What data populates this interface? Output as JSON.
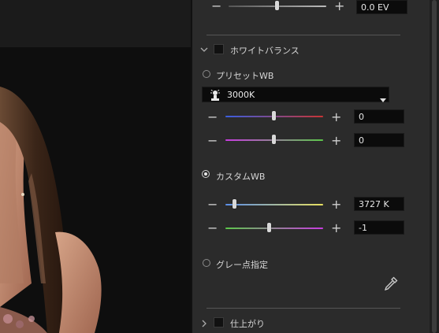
{
  "exposure": {
    "value": "0.0 EV",
    "slider_level": 0.5
  },
  "white_balance": {
    "title": "ホワイトバランス",
    "preset": {
      "label": "プリセットWB",
      "selected": "3000K",
      "icon": "light-bulb-icon",
      "slider1": {
        "value": "0",
        "level": 0.5
      },
      "slider2": {
        "value": "0",
        "level": 0.5
      }
    },
    "custom": {
      "label": "カスタムWB",
      "selected": true,
      "temperature": {
        "value": "3727 K",
        "level": 0.08
      },
      "tint": {
        "value": "-1",
        "level": 0.45
      }
    },
    "gray_point": {
      "label": "グレー点指定",
      "icon": "eyedropper-icon"
    }
  },
  "finishing": {
    "title": "仕上がり"
  },
  "symbols": {
    "minus": "−",
    "plus": "+"
  }
}
